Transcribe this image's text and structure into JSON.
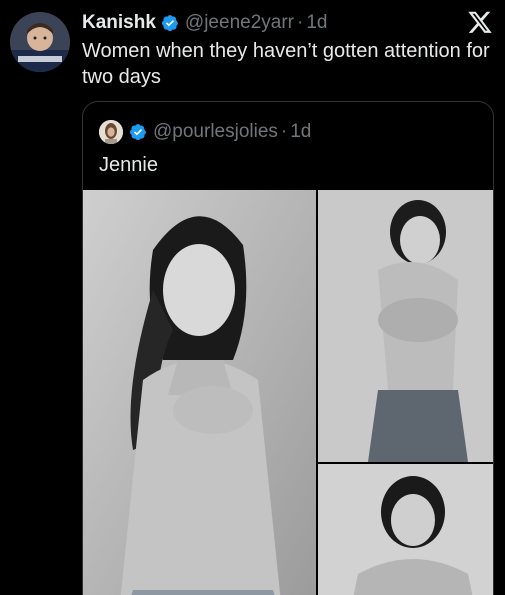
{
  "tweet": {
    "display_name": "Kanishk",
    "handle": "@jeene2yarr",
    "separator": "·",
    "time": "1d",
    "text": "Women when they haven’t gotten attention for two days",
    "avatar_icon": "profile-photo",
    "verified_icon": "verified-badge-icon",
    "platform_icon": "x-logo-icon"
  },
  "quoted": {
    "handle": "@pourlesjolies",
    "separator": "·",
    "time": "1d",
    "text": "Jennie",
    "avatar_icon": "profile-photo",
    "verified_icon": "verified-badge-icon",
    "media": [
      {
        "name": "photo-1",
        "description": "grayscale-photo"
      },
      {
        "name": "photo-2",
        "description": "grayscale-photo"
      },
      {
        "name": "photo-3",
        "description": "grayscale-photo"
      }
    ]
  },
  "colors": {
    "background": "#000000",
    "text_primary": "#e7e9ea",
    "text_secondary": "#71767b",
    "verified_blue": "#1d9bf0",
    "border": "#2f3336"
  }
}
